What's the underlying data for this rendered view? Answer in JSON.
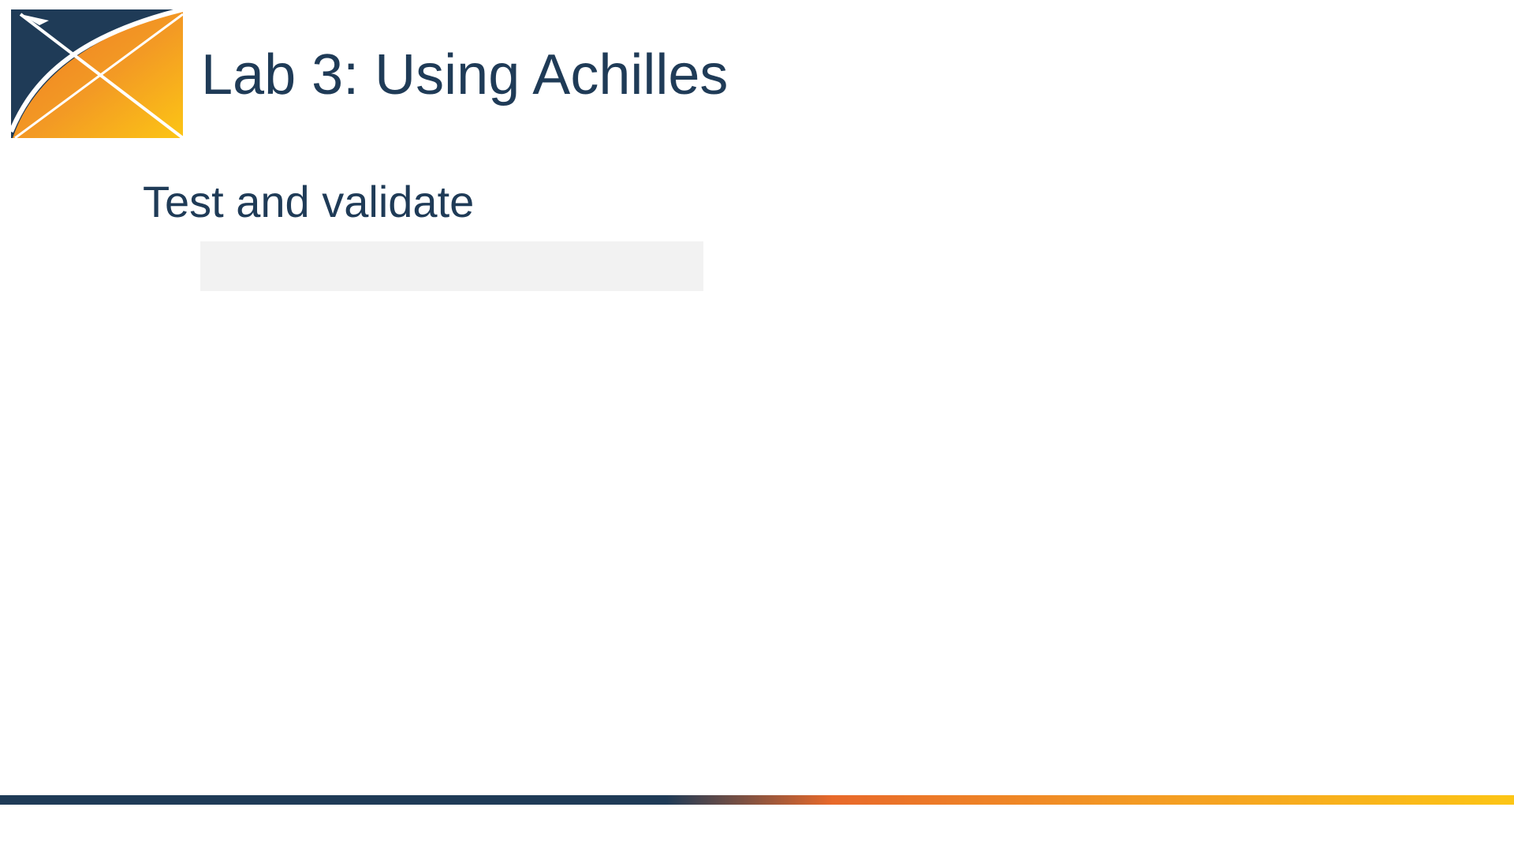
{
  "slide": {
    "title": "Lab 3: Using Achilles",
    "subtitle": "Test and validate",
    "code_box_text": ""
  },
  "logo": {
    "icon": "ohdsi-logo-icon"
  },
  "colors": {
    "title_text": "#1f3b57",
    "logo_navy": "#1f3b57",
    "logo_orange": "#f08a24",
    "logo_yellow": "#fcc515",
    "code_box_bg": "#f2f2f2",
    "footer_gradient": [
      "#1f3b57",
      "#e8692a",
      "#f39a24",
      "#fcc515"
    ]
  }
}
